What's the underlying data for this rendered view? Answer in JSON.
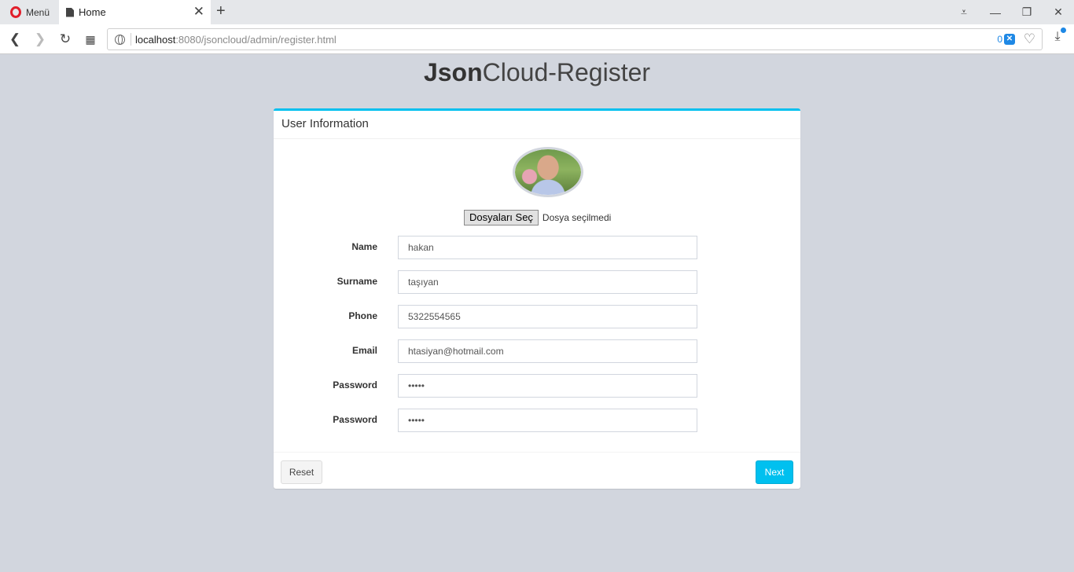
{
  "browser": {
    "menu_label": "Menü",
    "tab_title": "Home",
    "tab_close": "✕",
    "new_tab": "+",
    "url_host": "localhost",
    "url_rest": ":8080/jsoncloud/admin/register.html",
    "adblock_count": "0",
    "controls": {
      "minimize": "—",
      "restore": "❐",
      "close": "✕",
      "easy_setup": "⩡"
    }
  },
  "page": {
    "title_bold": "Json",
    "title_light": "Cloud-Register"
  },
  "box": {
    "header": "User Information",
    "file": {
      "button": "Dosyaları Seç",
      "status": "Dosya seçilmedi"
    },
    "fields": [
      {
        "label": "Name",
        "value": "hakan"
      },
      {
        "label": "Surname",
        "value": "taşıyan"
      },
      {
        "label": "Phone",
        "value": "5322554565"
      },
      {
        "label": "Email",
        "value": "htasiyan@hotmail.com"
      },
      {
        "label": "Password",
        "value": "•••••"
      },
      {
        "label": "Password",
        "value": "•••••"
      }
    ],
    "reset_label": "Reset",
    "next_label": "Next"
  },
  "colors": {
    "accent": "#00c0ef",
    "background": "#d2d6de",
    "opera_red": "#e11f2b"
  }
}
